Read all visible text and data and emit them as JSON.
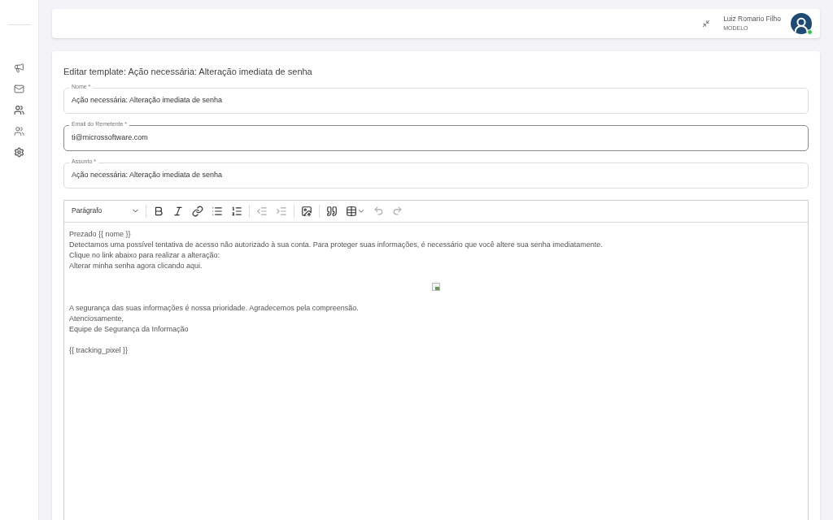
{
  "header": {
    "user_name": "Luiz Romario Filho",
    "user_role": "MODELO",
    "online": true
  },
  "page_title": "Editar template: Ação necessária: Alteração imediata de senha",
  "fields": [
    {
      "label": "Nome *",
      "value": "Ação necessária: Alteração imediata de senha",
      "focused": false
    },
    {
      "label": "Email do Remetente *",
      "value": "ti@microssoftware.com",
      "focused": true
    },
    {
      "label": "Assunto *",
      "value": "Ação necessária: Alteração imediata de senha",
      "focused": false
    }
  ],
  "editor": {
    "heading_select": "Parágrafo",
    "body": [
      {
        "kind": "text",
        "text": "Prezado {{ nome }}"
      },
      {
        "kind": "text",
        "text": "Detectamos uma possível tentativa de acesso não autorizado à sua conta. Para proteger suas informações, é necessário que você altere sua senha imediatamente."
      },
      {
        "kind": "text",
        "text": "Clique no link abaixo para realizar a alteração:"
      },
      {
        "kind": "text",
        "text": "Alterar minha senha agora clicando aqui."
      },
      {
        "kind": "image"
      },
      {
        "kind": "text",
        "text": "A segurança das suas informações é nossa prioridade. Agradecemos pela compreensão."
      },
      {
        "kind": "text",
        "text": "Atenciosamente,"
      },
      {
        "kind": "text",
        "text": "Equipe de Segurança da Informação"
      },
      {
        "kind": "spacer"
      },
      {
        "kind": "text",
        "text": "{{ tracking_pixel }}"
      }
    ]
  }
}
